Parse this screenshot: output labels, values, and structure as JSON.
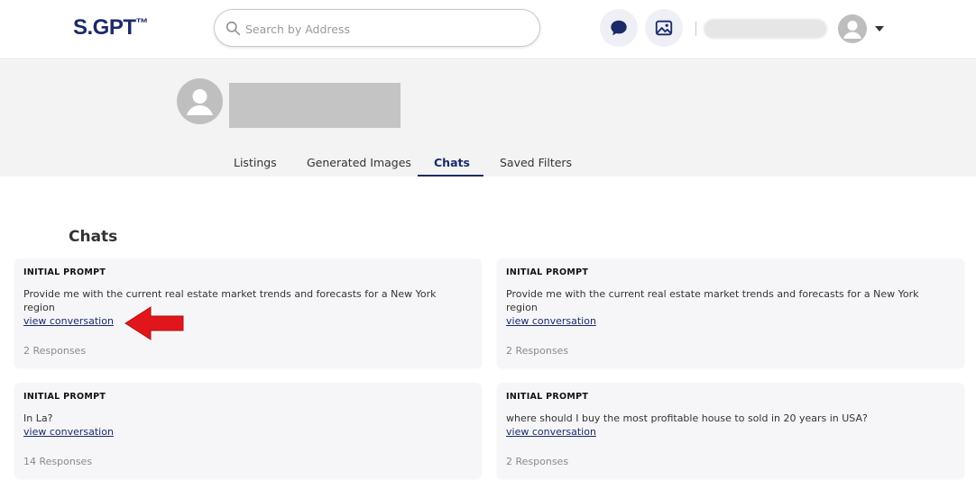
{
  "header": {
    "logo": "S.GPT",
    "logo_mark": "™",
    "search_placeholder": "Search by Address",
    "icons": [
      "search-icon",
      "chat-bubble-icon",
      "image-icon",
      "user-avatar-icon",
      "chevron-down-icon"
    ]
  },
  "profile": {
    "tabs": [
      {
        "label": "Listings"
      },
      {
        "label": "Generated Images"
      },
      {
        "label": "Chats"
      },
      {
        "label": "Saved Filters"
      }
    ],
    "active_tab": "Chats"
  },
  "main": {
    "title": "Chats",
    "cards": [
      {
        "label": "INITIAL PROMPT",
        "prompt": "Provide me with the current real estate market trends and forecasts for a New York region",
        "link": "view conversation",
        "responses": "2 Responses"
      },
      {
        "label": "INITIAL PROMPT",
        "prompt": "Provide me with the current real estate market trends and forecasts for a New York region",
        "link": "view conversation",
        "responses": "2 Responses"
      },
      {
        "label": "INITIAL PROMPT",
        "prompt": "In La?",
        "link": "view conversation",
        "responses": "14 Responses"
      },
      {
        "label": "INITIAL PROMPT",
        "prompt": "where should I buy the most profitable house to sold in 20 years in USA?",
        "link": "view conversation",
        "responses": "2 Responses"
      }
    ]
  },
  "colors": {
    "brand": "#1c2a6b",
    "annotation_arrow": "#e0161b"
  }
}
